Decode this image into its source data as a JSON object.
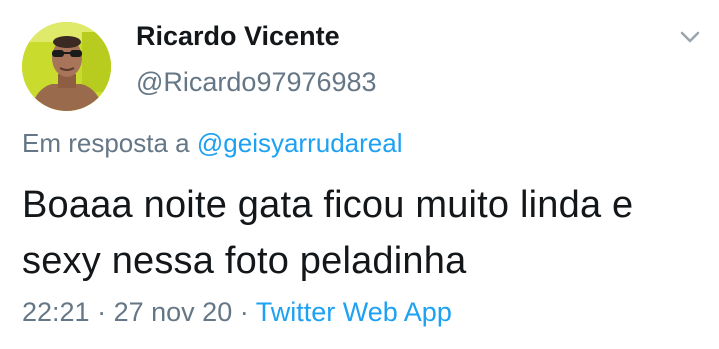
{
  "author": {
    "display_name": "Ricardo Vicente",
    "handle": "@Ricardo97976983"
  },
  "reply": {
    "prefix": "Em resposta a",
    "mention": "@geisyarrudareal"
  },
  "tweet": {
    "text": "Boaaa noite gata ficou muito linda e sexy nessa foto peladinha"
  },
  "meta": {
    "time": "22:21",
    "separator": "·",
    "date": "27 nov 20",
    "source": "Twitter Web App"
  },
  "icons": {
    "menu": "chevron-down-icon"
  },
  "colors": {
    "text_primary": "#14171a",
    "text_secondary": "#657786",
    "link": "#1da1f2",
    "avatar_background": "#c6d82a"
  }
}
